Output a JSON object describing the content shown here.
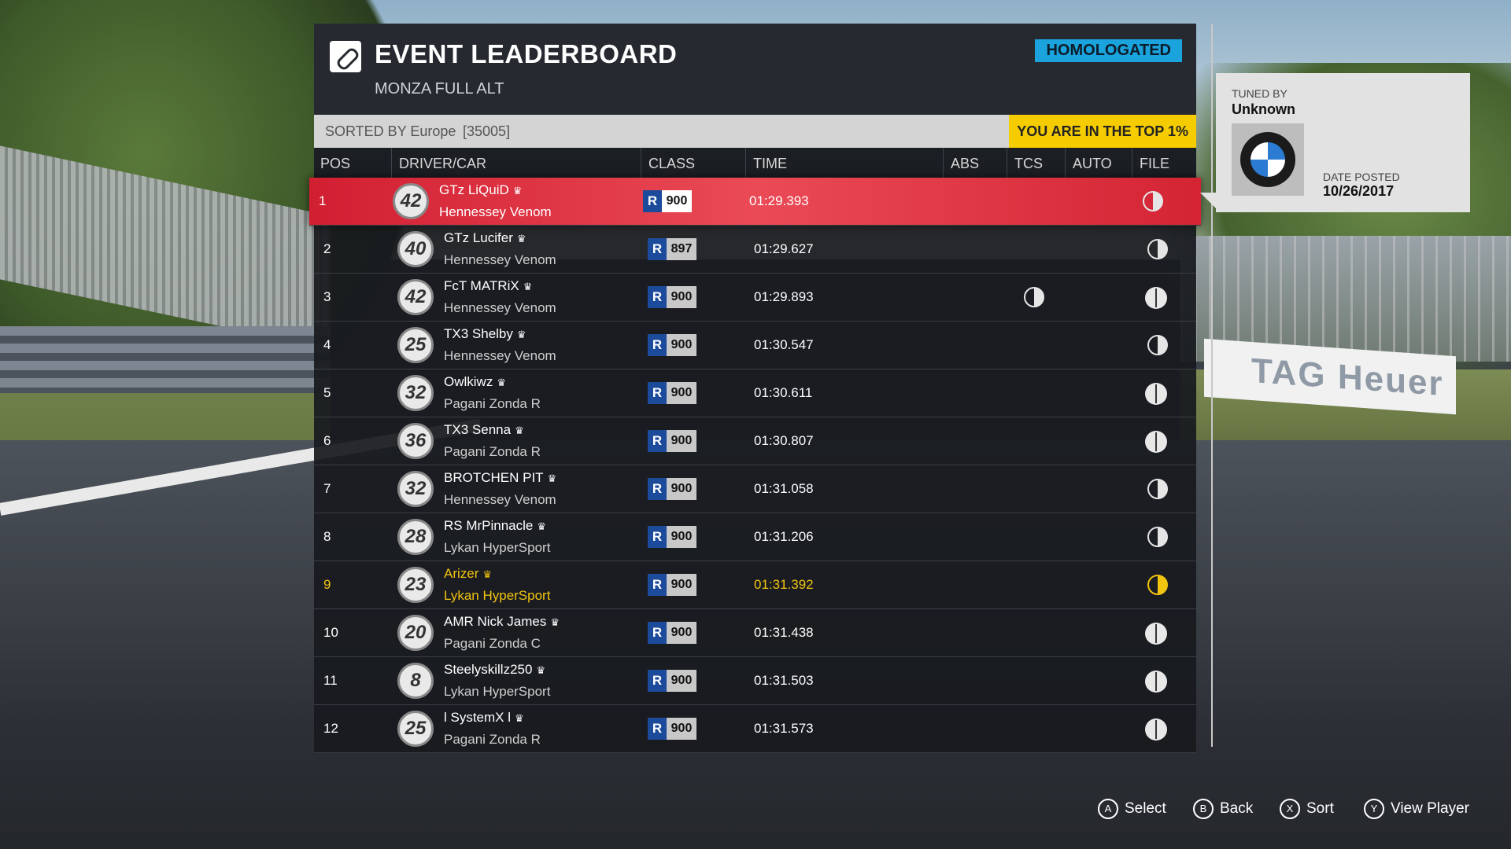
{
  "header": {
    "title": "EVENT LEADERBOARD",
    "subtitle": "MONZA FULL ALT",
    "badge": "HOMOLOGATED"
  },
  "sortbar": {
    "label": "SORTED BY Europe",
    "count": "[35005]",
    "top_percent": "YOU ARE IN THE TOP 1%"
  },
  "columns": [
    "POS",
    "DRIVER/CAR",
    "CLASS",
    "TIME",
    "ABS",
    "TCS",
    "AUTO",
    "FILE"
  ],
  "rows": [
    {
      "pos": "1",
      "number": "42",
      "driver": "GTz LiQuiD",
      "car": "Hennessey Venom",
      "cls": "R",
      "pi": "900",
      "time": "01:29.393",
      "tcs": "",
      "file": "half"
    },
    {
      "pos": "2",
      "number": "40",
      "driver": "GTz Lucifer",
      "car": "Hennessey Venom",
      "cls": "R",
      "pi": "897",
      "time": "01:29.627",
      "tcs": "",
      "file": "half"
    },
    {
      "pos": "3",
      "number": "42",
      "driver": "FcT MATRiX",
      "car": "Hennessey Venom",
      "cls": "R",
      "pi": "900",
      "time": "01:29.893",
      "tcs": "half",
      "file": "full"
    },
    {
      "pos": "4",
      "number": "25",
      "driver": "TX3 Shelby",
      "car": "Hennessey Venom",
      "cls": "R",
      "pi": "900",
      "time": "01:30.547",
      "tcs": "",
      "file": "half"
    },
    {
      "pos": "5",
      "number": "32",
      "driver": "Owlkiwz",
      "car": "Pagani Zonda R",
      "cls": "R",
      "pi": "900",
      "time": "01:30.611",
      "tcs": "",
      "file": "full"
    },
    {
      "pos": "6",
      "number": "36",
      "driver": "TX3 Senna",
      "car": "Pagani Zonda R",
      "cls": "R",
      "pi": "900",
      "time": "01:30.807",
      "tcs": "",
      "file": "full"
    },
    {
      "pos": "7",
      "number": "32",
      "driver": "BROTCHEN PIT",
      "car": "Hennessey Venom",
      "cls": "R",
      "pi": "900",
      "time": "01:31.058",
      "tcs": "",
      "file": "half"
    },
    {
      "pos": "8",
      "number": "28",
      "driver": "RS MrPinnacle",
      "car": "Lykan HyperSport",
      "cls": "R",
      "pi": "900",
      "time": "01:31.206",
      "tcs": "",
      "file": "half"
    },
    {
      "pos": "9",
      "number": "23",
      "driver": "Arizer",
      "car": "Lykan HyperSport",
      "cls": "R",
      "pi": "900",
      "time": "01:31.392",
      "tcs": "",
      "file": "half"
    },
    {
      "pos": "10",
      "number": "20",
      "driver": "AMR Nick James",
      "car": "Pagani Zonda C",
      "cls": "R",
      "pi": "900",
      "time": "01:31.438",
      "tcs": "",
      "file": "full"
    },
    {
      "pos": "11",
      "number": "8",
      "driver": "Steelyskillz250",
      "car": "Lykan HyperSport",
      "cls": "R",
      "pi": "900",
      "time": "01:31.503",
      "tcs": "",
      "file": "full"
    },
    {
      "pos": "12",
      "number": "25",
      "driver": "l SystemX l",
      "car": "Pagani Zonda R",
      "cls": "R",
      "pi": "900",
      "time": "01:31.573",
      "tcs": "",
      "file": "full"
    }
  ],
  "selected_row": 0,
  "player_row": 8,
  "card": {
    "tuned_label": "TUNED BY",
    "tuned_value": "Unknown",
    "date_label": "DATE POSTED",
    "date_value": "10/26/2017",
    "logo_icon": "bmw-logo-icon"
  },
  "footer": [
    {
      "button": "A",
      "label": "Select"
    },
    {
      "button": "B",
      "label": "Back"
    },
    {
      "button": "X",
      "label": "Sort"
    },
    {
      "button": "Y",
      "label": "View Player"
    }
  ],
  "background_sign": "TAG Heuer",
  "colors": {
    "selected": "#d11f32",
    "player": "#f1c40f",
    "badge": "#1aa3dd",
    "top_percent": "#f5cc00",
    "class_r": "#1c4b9c"
  }
}
